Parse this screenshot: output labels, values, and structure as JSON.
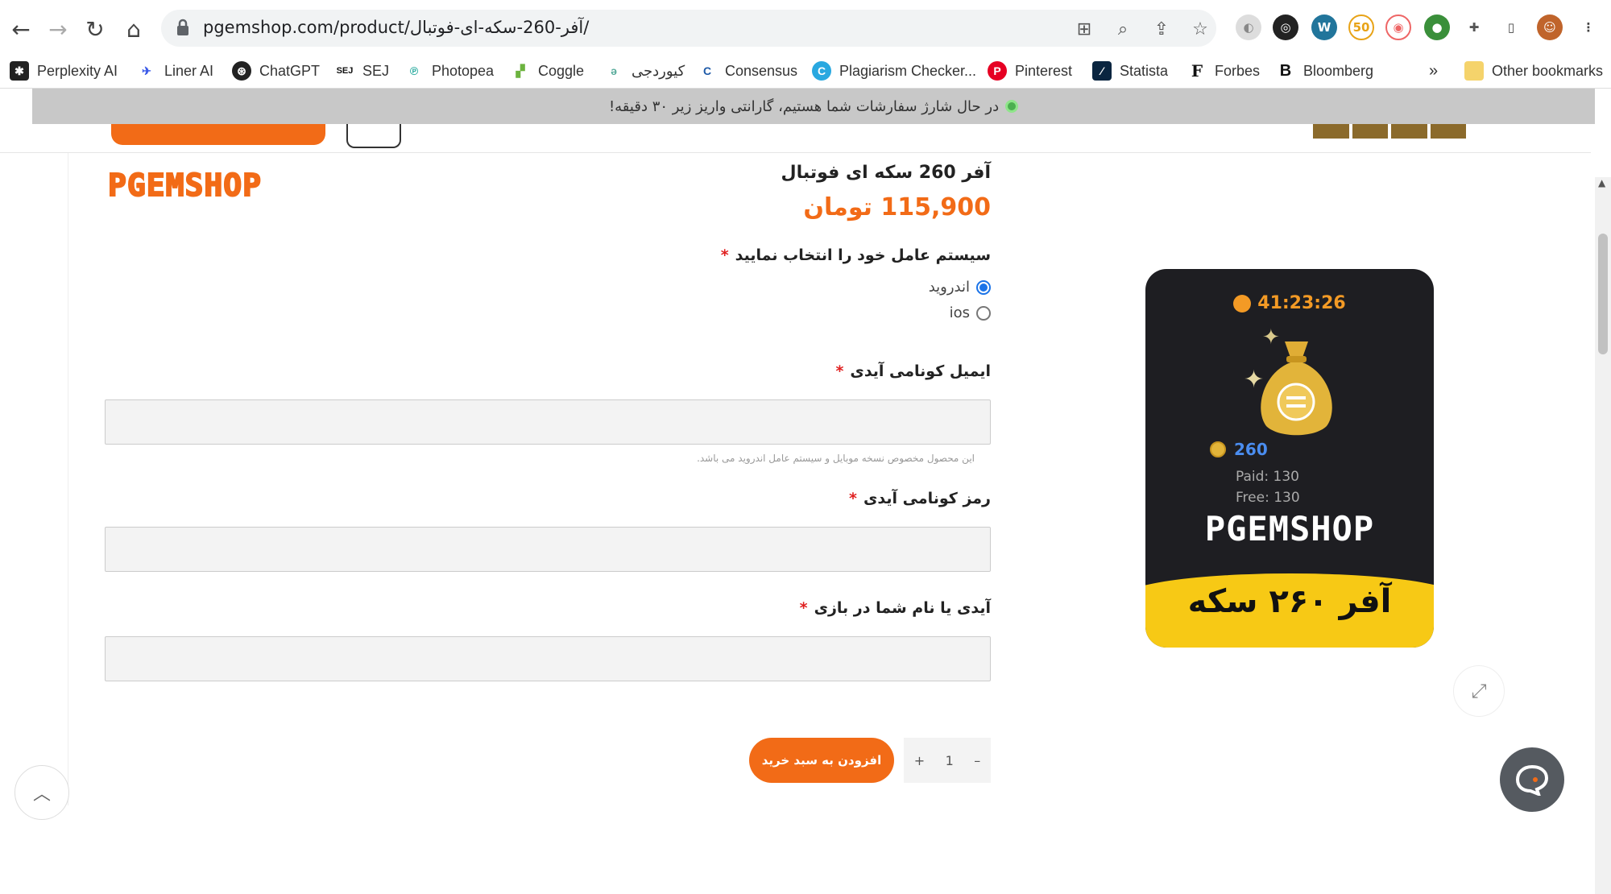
{
  "browser": {
    "url": "pgemshop.com/product/آفر-260-سکه-ای-فوتبال/",
    "bookmarks": [
      "Perplexity AI",
      "Liner AI",
      "ChatGPT",
      "SEJ",
      "Photopea",
      "Coggle",
      "کیوردجی",
      "Consensus",
      "Plagiarism Checker...",
      "Pinterest",
      "Statista",
      "Forbes",
      "Bloomberg"
    ],
    "more": "»",
    "other_bookmarks": "Other bookmarks"
  },
  "notice": "در حال شارژ سفارشات شما هستیم، گارانتی واریز زیر ۳۰ دقیقه!",
  "logo": "PGEMSHOP",
  "product": {
    "title": "آفر 260 سکه ای فوتبال",
    "price": "115,900 تومان"
  },
  "form": {
    "os_label": "سیستم عامل خود را انتخاب نمایید",
    "os_options": [
      "اندروید",
      "ios"
    ],
    "os_selected": 0,
    "email_label": "ایمیل کونامی آیدی",
    "email_hint": "این محصول مخصوص نسخه موبایل و سیستم عامل اندروید می باشد.",
    "password_label": "رمز کونامی آیدی",
    "game_id_label": "آیدی یا نام شما در بازی",
    "required_mark": "*"
  },
  "cart": {
    "quantity": "1",
    "minus": "–",
    "plus": "+",
    "add_label": "افزودن به سبد خرید"
  },
  "card": {
    "timer": "41:23:26",
    "coins": "260",
    "paid": "Paid: 130",
    "free": "Free: 130",
    "logo": "PGEMSHOP",
    "offer": "آفر ۲۶۰ سکه"
  },
  "colors": {
    "accent": "#f26b17",
    "card_bg": "#1e1e22",
    "card_yellow": "#f7c915",
    "coins_blue": "#4a8df0"
  }
}
